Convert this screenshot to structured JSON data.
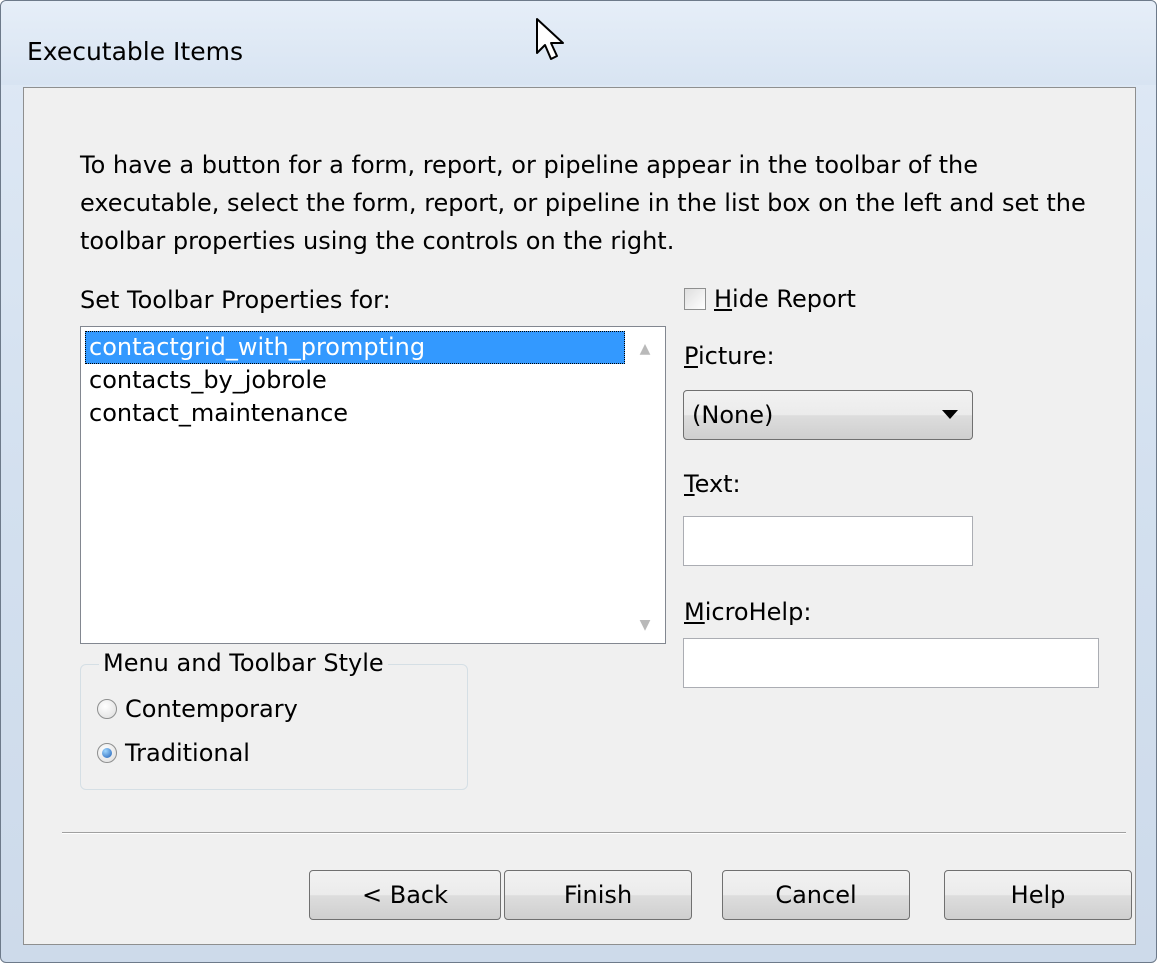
{
  "window": {
    "title": "Executable Items"
  },
  "instructions": "To have a button for a form, report, or pipeline appear in the toolbar of the executable, select the form, report, or pipeline in the list box on the left and set the toolbar properties using the controls on the right.",
  "list": {
    "label": "Set Toolbar Properties for:",
    "items": [
      "contactgrid_with_prompting",
      "contacts_by_jobrole",
      "contact_maintenance"
    ],
    "selected": "contactgrid_with_prompting"
  },
  "style_group": {
    "legend": "Menu and Toolbar Style",
    "options": [
      {
        "label": "Contemporary",
        "checked": false
      },
      {
        "label": "Traditional",
        "checked": true
      }
    ]
  },
  "hide_report": {
    "label_mnemonic": "H",
    "label_rest": "ide Report",
    "checked": false
  },
  "picture": {
    "label_mnemonic": "P",
    "label_rest": "icture:",
    "value": "(None)"
  },
  "text_field": {
    "label_mnemonic": "T",
    "label_rest": "ext:",
    "value": ""
  },
  "microhelp": {
    "label_mnemonic": "M",
    "label_rest": "icroHelp:",
    "value": ""
  },
  "buttons": {
    "back": "< Back",
    "finish": "Finish",
    "cancel": "Cancel",
    "help": "Help"
  },
  "colors": {
    "selection": "#3399ff",
    "client_bg": "#f0f0f0",
    "title_bg": "#dbe6f3"
  }
}
